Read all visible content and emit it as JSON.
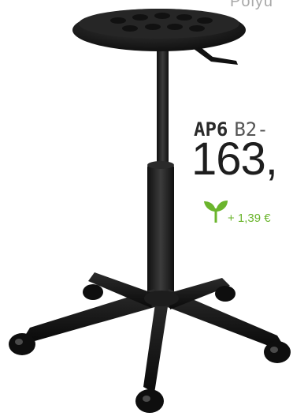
{
  "product": {
    "material_partial": "Polyu",
    "code": "AP6",
    "variant_partial": "B2-",
    "price_partial": "163,",
    "eco_surcharge": "+ 1,39 €"
  },
  "colors": {
    "eco_green": "#6bb52d",
    "stool_black": "#1a1a1a"
  },
  "icons": {
    "eco_leaf": "leaf-sprout-icon"
  }
}
